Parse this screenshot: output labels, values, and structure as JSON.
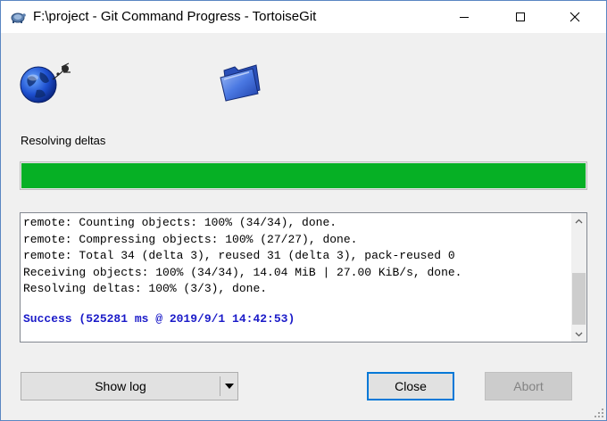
{
  "window": {
    "title": "F:\\project - Git Command Progress - TortoiseGit"
  },
  "status": {
    "label": "Resolving deltas",
    "progress_fraction": 1.0
  },
  "log": {
    "lines": [
      "remote: Counting objects: 100% (34/34), done.",
      "remote: Compressing objects: 100% (27/27), done.",
      "remote: Total 34 (delta 3), reused 31 (delta 3), pack-reused 0",
      "Receiving objects: 100% (34/34), 14.04 MiB | 27.00 KiB/s, done.",
      "Resolving deltas: 100% (3/3), done."
    ],
    "success": "Success (525281 ms @ 2019/9/1 14:42:53)"
  },
  "buttons": {
    "show_log": "Show log",
    "close": "Close",
    "abort": "Abort"
  },
  "icons": {
    "app": "tortoisegit-icon",
    "globe": "remote-globe-icon",
    "folder": "local-folder-icon"
  },
  "colors": {
    "progress": "#06b025",
    "success_text": "#1a1ac8",
    "accent": "#0078d7"
  }
}
